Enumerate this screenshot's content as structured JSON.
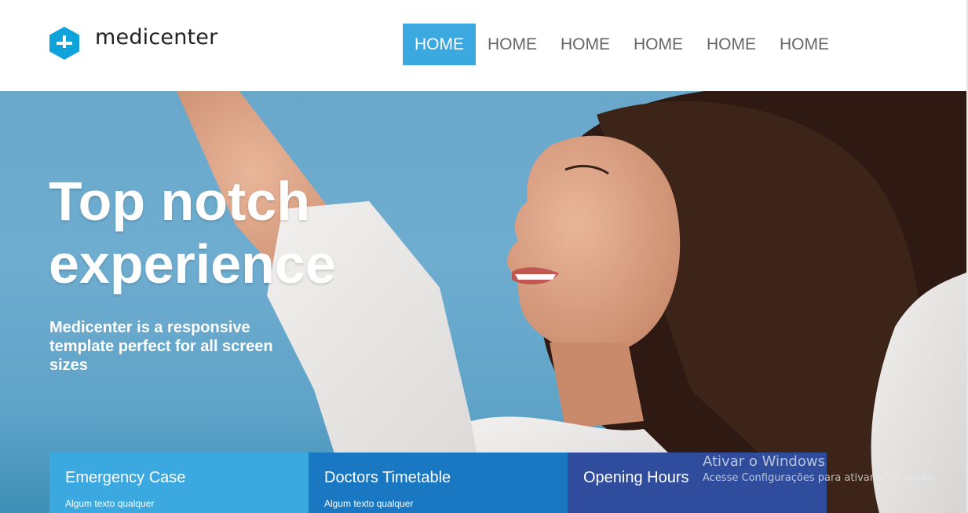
{
  "header": {
    "logo": {
      "text": "medicenter",
      "icon": "plus-hexagon-icon",
      "color": "#0fa3dc"
    },
    "nav": [
      {
        "label": "HOME",
        "active": true
      },
      {
        "label": "HOME",
        "active": false
      },
      {
        "label": "HOME",
        "active": false
      },
      {
        "label": "HOME",
        "active": false
      },
      {
        "label": "HOME",
        "active": false
      },
      {
        "label": "HOME",
        "active": false
      }
    ],
    "active_color": "#3ba8e0"
  },
  "hero": {
    "title_line1": "Top notch",
    "title_line2": "experience",
    "subtitle": "Medicenter is a responsive template perfect for all screen sizes"
  },
  "boxes": [
    {
      "title": "Emergency Case",
      "text": "Algum texto qualquer",
      "color": "#3ba8e0"
    },
    {
      "title": "Doctors Timetable",
      "text": "Algum texto qualquer",
      "color": "#1a78c2"
    },
    {
      "title": "Opening Hours",
      "text": "",
      "color": "#2f4d9c"
    }
  ],
  "watermark": {
    "title": "Ativar o Windows",
    "subtitle": "Acesse Configurações para ativar o Windows."
  }
}
